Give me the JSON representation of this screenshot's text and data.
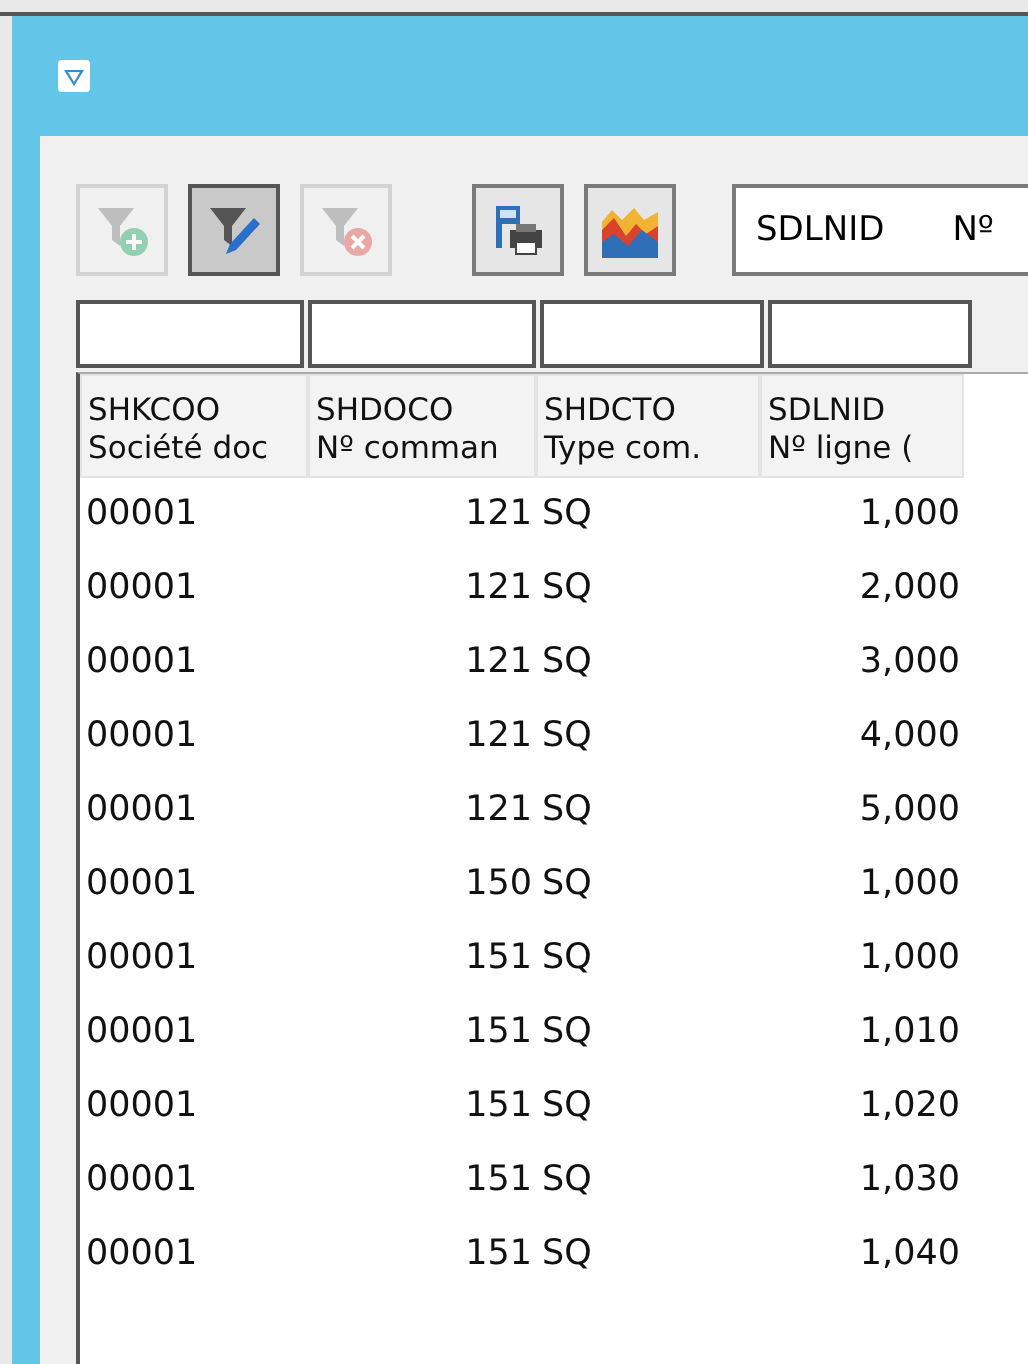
{
  "toolbar": {
    "buttons": [
      {
        "kind": "filter-add",
        "disabled": true,
        "pressed": false
      },
      {
        "kind": "filter-edit",
        "disabled": false,
        "pressed": true
      },
      {
        "kind": "filter-remove",
        "disabled": true,
        "pressed": false
      },
      {
        "kind": "print",
        "disabled": false,
        "pressed": false
      },
      {
        "kind": "chart",
        "disabled": false,
        "pressed": false
      }
    ],
    "column_select": {
      "value": "SDLNID",
      "description": "Nº"
    }
  },
  "table": {
    "columns": [
      {
        "code": "SHKCOO",
        "label": "Société doc",
        "numeric": false
      },
      {
        "code": "SHDOCO",
        "label": "Nº comman",
        "numeric": true
      },
      {
        "code": "SHDCTO",
        "label": "Type com.",
        "numeric": false
      },
      {
        "code": "SDLNID",
        "label": "Nº ligne (",
        "numeric": true
      }
    ],
    "rows": [
      [
        "00001",
        "121",
        "SQ",
        "1,000"
      ],
      [
        "00001",
        "121",
        "SQ",
        "2,000"
      ],
      [
        "00001",
        "121",
        "SQ",
        "3,000"
      ],
      [
        "00001",
        "121",
        "SQ",
        "4,000"
      ],
      [
        "00001",
        "121",
        "SQ",
        "5,000"
      ],
      [
        "00001",
        "150",
        "SQ",
        "1,000"
      ],
      [
        "00001",
        "151",
        "SQ",
        "1,000"
      ],
      [
        "00001",
        "151",
        "SQ",
        "1,010"
      ],
      [
        "00001",
        "151",
        "SQ",
        "1,020"
      ],
      [
        "00001",
        "151",
        "SQ",
        "1,030"
      ],
      [
        "00001",
        "151",
        "SQ",
        "1,040"
      ]
    ]
  }
}
